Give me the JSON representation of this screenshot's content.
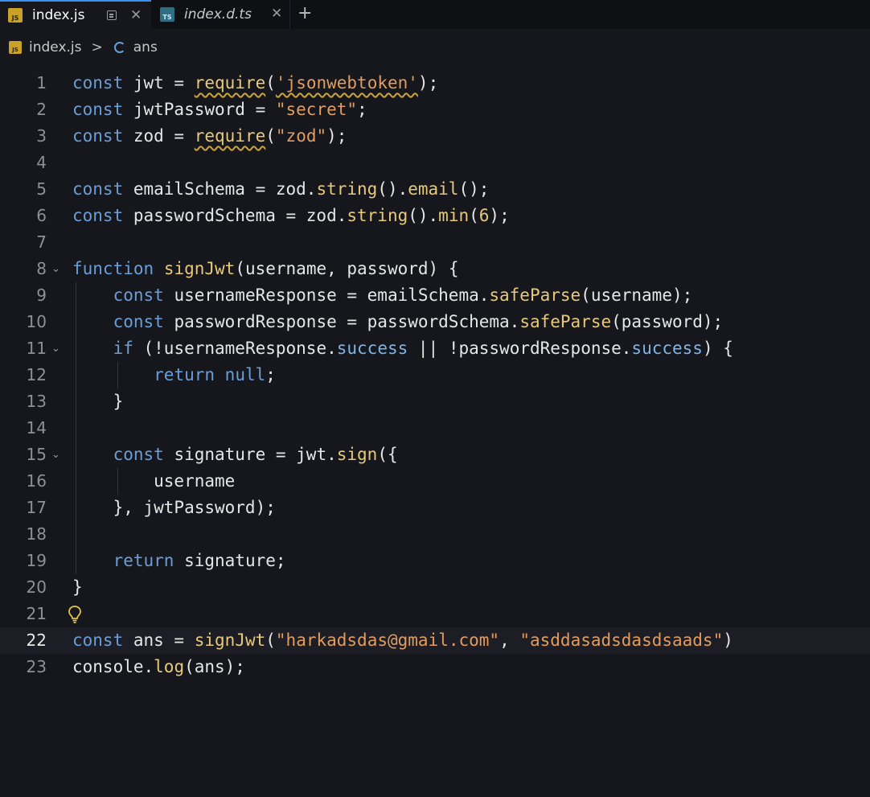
{
  "tabs": [
    {
      "label": "index.js",
      "icon": "js-file-icon",
      "badge": "JS",
      "active": true
    },
    {
      "label": "index.d.ts",
      "icon": "ts-file-icon",
      "badge": "TS",
      "active": false
    }
  ],
  "breadcrumb": {
    "badge": "JS",
    "file": "index.js",
    "separator": ">",
    "symbol": "ans"
  },
  "editor": {
    "current_line": 22,
    "lines": [
      {
        "n": "1",
        "text": "const jwt = require('jsonwebtoken');"
      },
      {
        "n": "2",
        "text": "const jwtPassword = \"secret\";"
      },
      {
        "n": "3",
        "text": "const zod = require(\"zod\");"
      },
      {
        "n": "4",
        "text": ""
      },
      {
        "n": "5",
        "text": "const emailSchema = zod.string().email();"
      },
      {
        "n": "6",
        "text": "const passwordSchema = zod.string().min(6);"
      },
      {
        "n": "7",
        "text": ""
      },
      {
        "n": "8",
        "text": "function signJwt(username, password) {"
      },
      {
        "n": "9",
        "text": "    const usernameResponse = emailSchema.safeParse(username);"
      },
      {
        "n": "10",
        "text": "    const passwordResponse = passwordSchema.safeParse(password);"
      },
      {
        "n": "11",
        "text": "    if (!usernameResponse.success || !passwordResponse.success) {"
      },
      {
        "n": "12",
        "text": "        return null;"
      },
      {
        "n": "13",
        "text": "    }"
      },
      {
        "n": "14",
        "text": ""
      },
      {
        "n": "15",
        "text": "    const signature = jwt.sign({"
      },
      {
        "n": "16",
        "text": "        username"
      },
      {
        "n": "17",
        "text": "    }, jwtPassword);"
      },
      {
        "n": "18",
        "text": ""
      },
      {
        "n": "19",
        "text": "    return signature;"
      },
      {
        "n": "20",
        "text": "}"
      },
      {
        "n": "21",
        "text": ""
      },
      {
        "n": "22",
        "text": "const ans = signJwt(\"harkadsdas@gmail.com\", \"asddasadsdasdsaads\")"
      },
      {
        "n": "23",
        "text": "console.log(ans);"
      }
    ]
  }
}
